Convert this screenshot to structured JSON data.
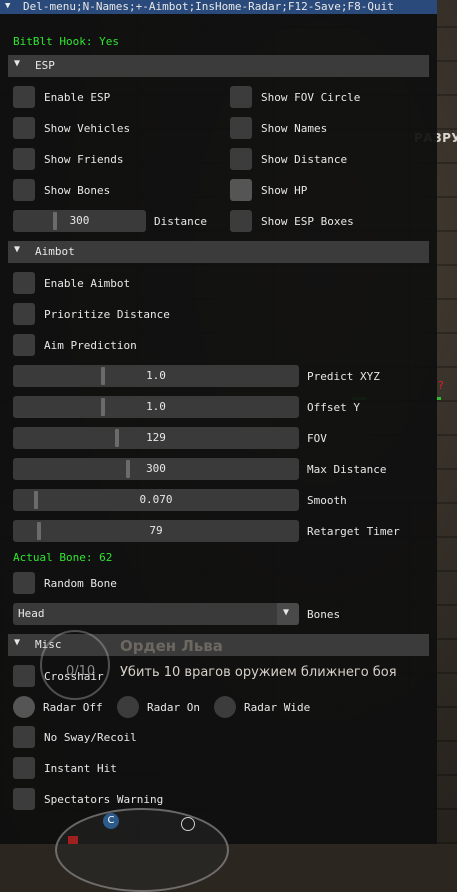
{
  "title_bar": {
    "text": "Del-menu;N-Names;+-Aimbot;InsHome-Radar;F12-Save;F8-Quit",
    "arrow": "▼"
  },
  "hook_status": "BitBlt Hook: Yes",
  "esp": {
    "header": "ESP",
    "left": [
      "Enable ESP",
      "Show Vehicles",
      "Show Friends",
      "Show Bones"
    ],
    "right": [
      "Show FOV Circle",
      "Show Names",
      "Show Distance",
      "Show HP",
      "Show ESP Boxes"
    ],
    "distance": {
      "value": "300",
      "label": "Distance"
    }
  },
  "aimbot": {
    "header": "Aimbot",
    "checks": [
      "Enable Aimbot",
      "Prioritize Distance",
      "Aim Prediction"
    ],
    "sliders": [
      {
        "value": "1.0",
        "label": "Predict XYZ",
        "fraction": 0.31
      },
      {
        "value": "1.0",
        "label": "Offset Y",
        "fraction": 0.31
      },
      {
        "value": "129",
        "label": "FOV",
        "fraction": 0.36
      },
      {
        "value": "300",
        "label": "Max Distance",
        "fraction": 0.4
      },
      {
        "value": "0.070",
        "label": "Smooth",
        "fraction": 0.07
      },
      {
        "value": "79",
        "label": "Retarget Timer",
        "fraction": 0.08
      }
    ],
    "actual_bone": "Actual Bone: 62",
    "random_bone": "Random Bone",
    "bones_combo": {
      "value": "Head",
      "label": "Bones",
      "arrow": "▼"
    }
  },
  "misc": {
    "header": "Misc",
    "crosshair": "Crosshair",
    "radar": [
      "Radar Off",
      "Radar On",
      "Radar Wide"
    ],
    "checks": [
      "No Sway/Recoil",
      "Instant Hit",
      "Spectators Warning"
    ]
  },
  "game": {
    "label": "РАЗРУ",
    "award_title": "Орден Льва",
    "award_desc": "Убить 10 врагов оружием ближнего боя",
    "award_count": "0/10",
    "compass_letter": "C",
    "marker": "?"
  },
  "colors": {
    "accent": "#294a7a",
    "status_green": "#2fe62f",
    "panel_bg": "#0f0f0f",
    "header_bg": "#3b3b3b",
    "widget_bg": "#3c3c3c"
  }
}
